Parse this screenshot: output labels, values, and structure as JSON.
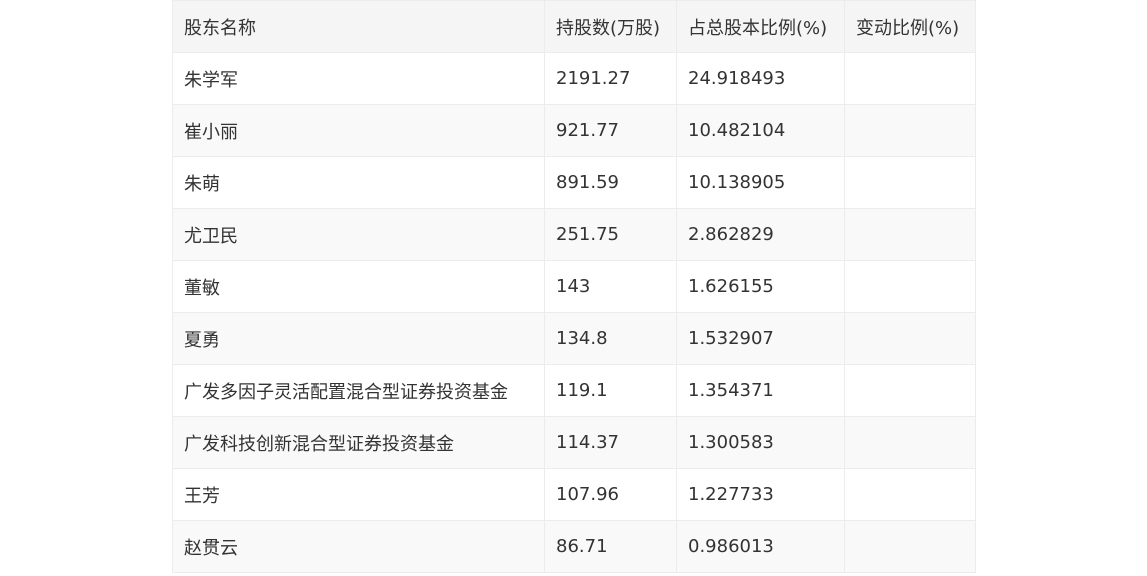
{
  "table": {
    "headers": [
      "股东名称",
      "持股数(万股)",
      "占总股本比例(%)",
      "变动比例(%)"
    ],
    "rows": [
      {
        "name": "朱学军",
        "shares": "2191.27",
        "ratio": "24.918493",
        "change": ""
      },
      {
        "name": "崔小丽",
        "shares": "921.77",
        "ratio": "10.482104",
        "change": ""
      },
      {
        "name": "朱萌",
        "shares": "891.59",
        "ratio": "10.138905",
        "change": ""
      },
      {
        "name": "尤卫民",
        "shares": "251.75",
        "ratio": "2.862829",
        "change": ""
      },
      {
        "name": "董敏",
        "shares": "143",
        "ratio": "1.626155",
        "change": ""
      },
      {
        "name": "夏勇",
        "shares": "134.8",
        "ratio": "1.532907",
        "change": ""
      },
      {
        "name": "广发多因子灵活配置混合型证券投资基金",
        "shares": "119.1",
        "ratio": "1.354371",
        "change": ""
      },
      {
        "name": "广发科技创新混合型证券投资基金",
        "shares": "114.37",
        "ratio": "1.300583",
        "change": ""
      },
      {
        "name": "王芳",
        "shares": "107.96",
        "ratio": "1.227733",
        "change": ""
      },
      {
        "name": "赵贯云",
        "shares": "86.71",
        "ratio": "0.986013",
        "change": ""
      }
    ]
  }
}
